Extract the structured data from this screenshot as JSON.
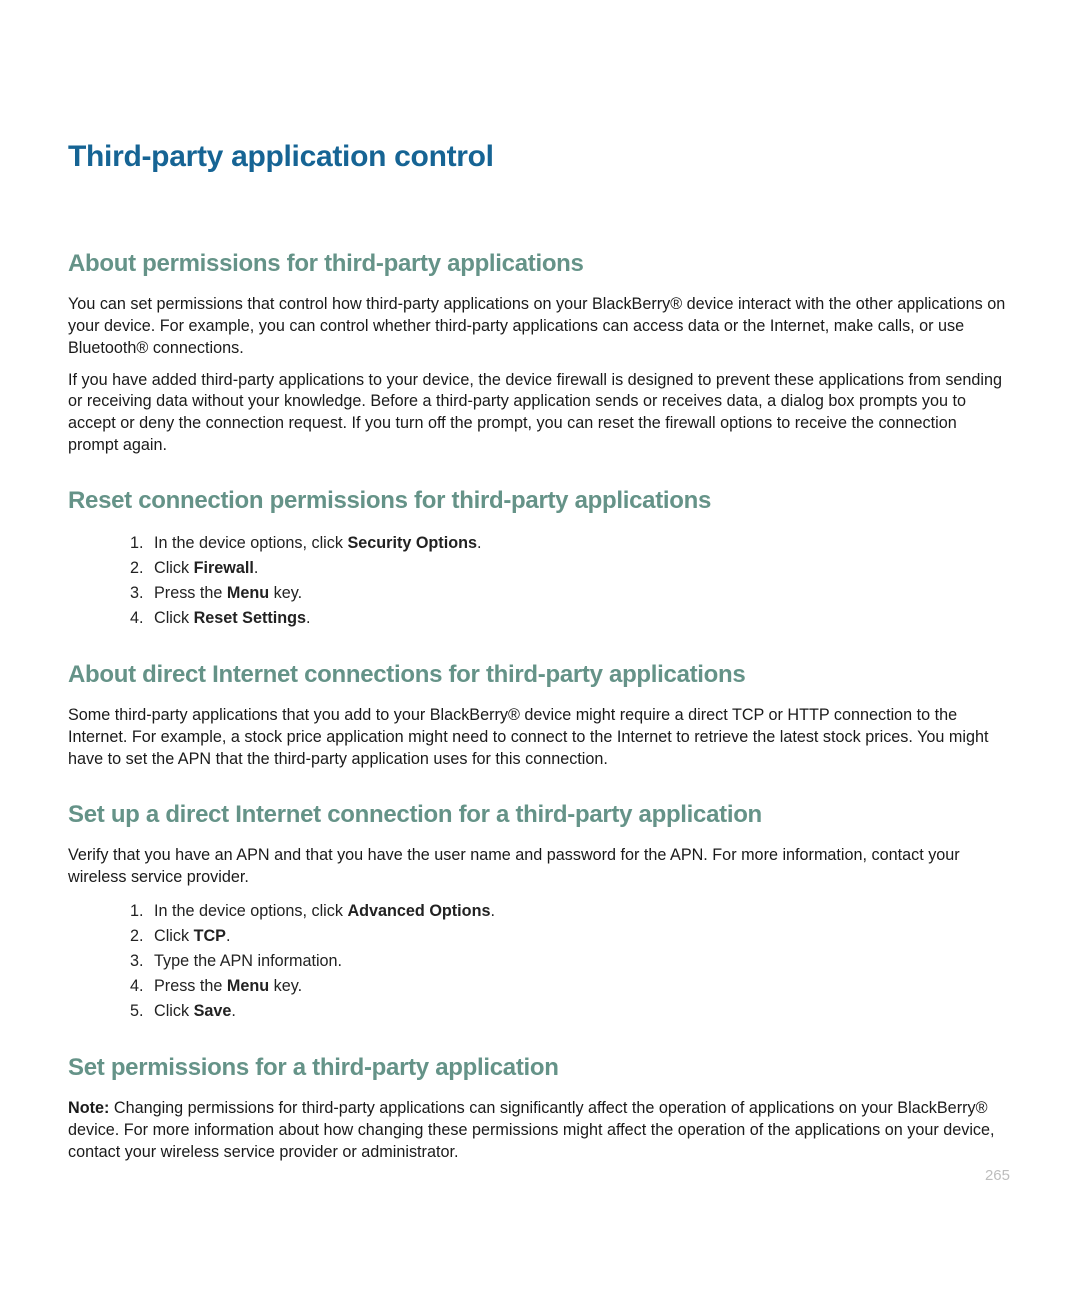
{
  "page_number": "265",
  "h1": "Third-party application control",
  "sections": {
    "s1": {
      "title": "About permissions for third-party applications",
      "p1": "You can set permissions that control how third-party applications on your BlackBerry® device interact with the other applications on your device. For example, you can control whether third-party applications can access data or the Internet, make calls, or use Bluetooth® connections.",
      "p2": "If you have added third-party applications to your device, the device firewall is designed to prevent these applications from sending or receiving data without your knowledge. Before a third-party application sends or receives data, a dialog box prompts you to accept or deny the connection request. If you turn off the prompt, you can reset the firewall options to receive the connection prompt again."
    },
    "s2": {
      "title": "Reset connection permissions for third-party applications",
      "steps": {
        "i1a": "In the device options, click ",
        "i1b": "Security Options",
        "i1c": ".",
        "i2a": "Click ",
        "i2b": "Firewall",
        "i2c": ".",
        "i3a": "Press the ",
        "i3b": "Menu",
        "i3c": " key.",
        "i4a": "Click ",
        "i4b": "Reset Settings",
        "i4c": "."
      }
    },
    "s3": {
      "title": "About direct Internet connections for third-party applications",
      "p1": "Some third-party applications that you add to your BlackBerry® device might require a direct TCP or HTTP connection to the Internet. For example, a stock price application might need to connect to the Internet to retrieve the latest stock prices. You might have to set the APN that the third-party application uses for this connection."
    },
    "s4": {
      "title": "Set up a direct Internet connection for a third-party application",
      "p1": "Verify that you have an APN and that you have the user name and password for the APN. For more information, contact your wireless service provider.",
      "steps": {
        "i1a": "In the device options, click ",
        "i1b": "Advanced Options",
        "i1c": ".",
        "i2a": "Click ",
        "i2b": "TCP",
        "i2c": ".",
        "i3": "Type the APN information.",
        "i4a": "Press the ",
        "i4b": "Menu",
        "i4c": " key.",
        "i5a": "Click ",
        "i5b": "Save",
        "i5c": "."
      }
    },
    "s5": {
      "title": "Set permissions for a third-party application",
      "note_label": "Note:",
      "note_body": "  Changing permissions for third-party applications can significantly affect the operation of applications on your BlackBerry® device. For more information about how changing these permissions might affect the operation of the applications on your device, contact your wireless service provider or administrator."
    }
  }
}
